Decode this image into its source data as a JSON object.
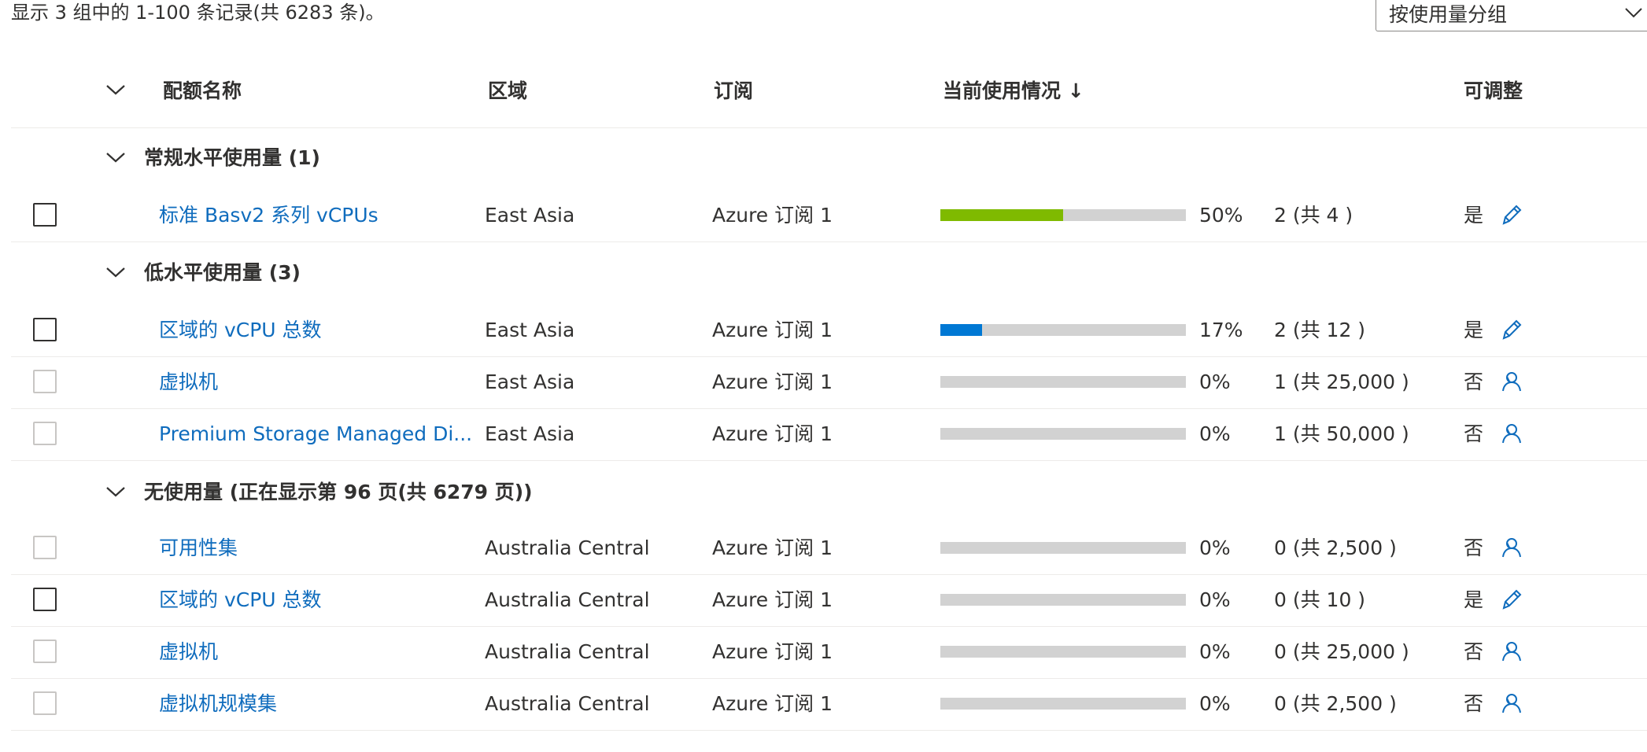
{
  "summary": "显示 3 组中的 1-100 条记录(共 6283 条)。",
  "group_by": {
    "value": "按使用量分组"
  },
  "columns": {
    "name": "配额名称",
    "region": "区域",
    "subscription": "订阅",
    "usage": "当前使用情况 ↓",
    "adjustable": "可调整"
  },
  "colors": {
    "link": "#0f6cbd",
    "bar_track": "#d2d2d2",
    "green": "#7fba00",
    "blue": "#0078d4"
  },
  "groups": [
    {
      "title": "常规水平使用量 (1)",
      "rows": [
        {
          "name": "标准 Basv2 系列 vCPUs",
          "region": "East Asia",
          "subscription": "Azure 订阅 1",
          "usage_fraction": 0.5,
          "bar_color": "#7fba00",
          "percent": "50%",
          "count": "2 (共 4 )",
          "adjustable": "是",
          "icon": "edit-icon",
          "checkbox_enabled": true
        }
      ]
    },
    {
      "title": "低水平使用量 (3)",
      "rows": [
        {
          "name": "区域的 vCPU 总数",
          "region": "East Asia",
          "subscription": "Azure 订阅 1",
          "usage_fraction": 0.17,
          "bar_color": "#0078d4",
          "percent": "17%",
          "count": "2 (共 12 )",
          "adjustable": "是",
          "icon": "edit-icon",
          "checkbox_enabled": true
        },
        {
          "name": "虚拟机",
          "region": "East Asia",
          "subscription": "Azure 订阅 1",
          "usage_fraction": 0,
          "bar_color": "#0078d4",
          "percent": "0%",
          "count": "1 (共 25,000 )",
          "adjustable": "否",
          "icon": "support-person-icon",
          "checkbox_enabled": false
        },
        {
          "name": "Premium Storage Managed Di...",
          "region": "East Asia",
          "subscription": "Azure 订阅 1",
          "usage_fraction": 0,
          "bar_color": "#0078d4",
          "percent": "0%",
          "count": "1 (共 50,000 )",
          "adjustable": "否",
          "icon": "support-person-icon",
          "checkbox_enabled": false
        }
      ]
    },
    {
      "title": "无使用量 (正在显示第 96 页(共 6279 页))",
      "rows": [
        {
          "name": "可用性集",
          "region": "Australia Central",
          "subscription": "Azure 订阅 1",
          "usage_fraction": 0,
          "bar_color": "#0078d4",
          "percent": "0%",
          "count": "0 (共 2,500 )",
          "adjustable": "否",
          "icon": "support-person-icon",
          "checkbox_enabled": false
        },
        {
          "name": "区域的 vCPU 总数",
          "region": "Australia Central",
          "subscription": "Azure 订阅 1",
          "usage_fraction": 0,
          "bar_color": "#0078d4",
          "percent": "0%",
          "count": "0 (共 10 )",
          "adjustable": "是",
          "icon": "edit-icon",
          "checkbox_enabled": true
        },
        {
          "name": "虚拟机",
          "region": "Australia Central",
          "subscription": "Azure 订阅 1",
          "usage_fraction": 0,
          "bar_color": "#0078d4",
          "percent": "0%",
          "count": "0 (共 25,000 )",
          "adjustable": "否",
          "icon": "support-person-icon",
          "checkbox_enabled": false
        },
        {
          "name": "虚拟机规模集",
          "region": "Australia Central",
          "subscription": "Azure 订阅 1",
          "usage_fraction": 0,
          "bar_color": "#0078d4",
          "percent": "0%",
          "count": "0 (共 2,500 )",
          "adjustable": "否",
          "icon": "support-person-icon",
          "checkbox_enabled": false
        }
      ]
    }
  ]
}
